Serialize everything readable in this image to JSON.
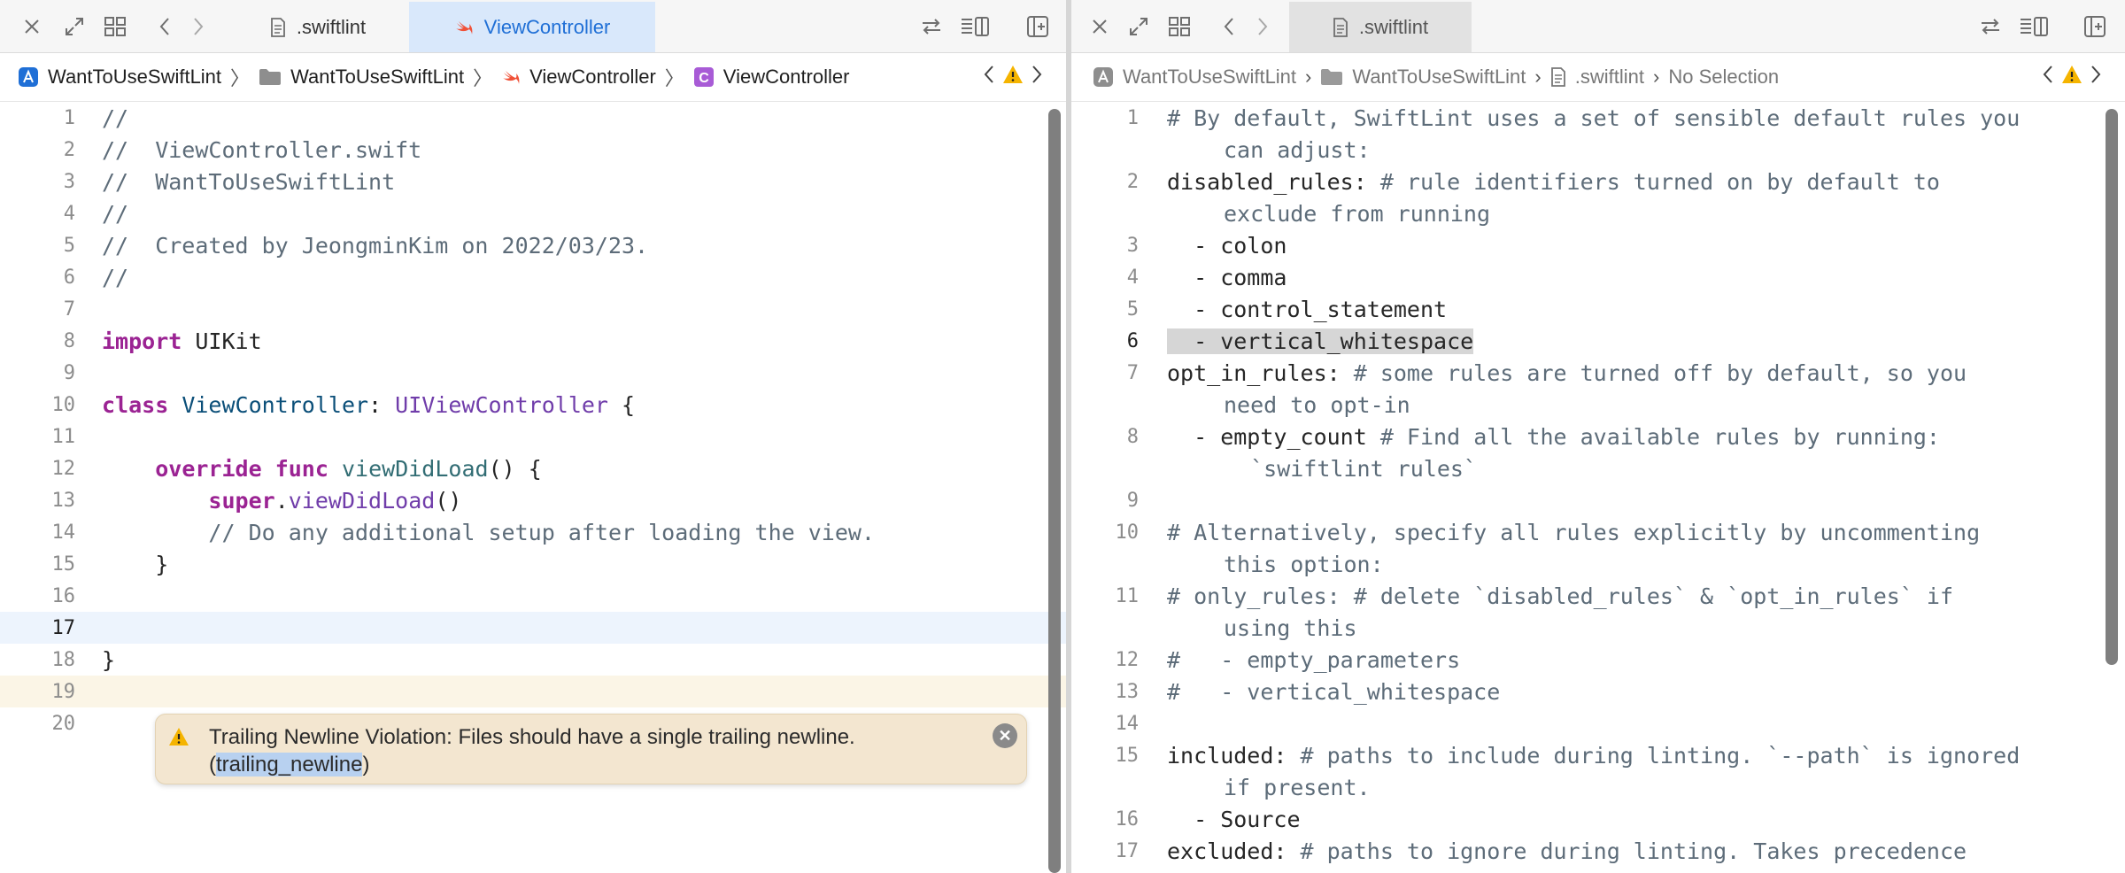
{
  "left_pane": {
    "tabs": [
      {
        "label": ".swiftlint"
      },
      {
        "label": "ViewController"
      }
    ],
    "breadcrumbs": [
      "WantToUseSwiftLint",
      "WantToUseSwiftLint",
      "ViewController",
      "ViewController"
    ],
    "current_line": "17",
    "lines": [
      {
        "n": "1",
        "text": "//"
      },
      {
        "n": "2",
        "text": "//  ViewController.swift"
      },
      {
        "n": "3",
        "text": "//  WantToUseSwiftLint"
      },
      {
        "n": "4",
        "text": "//"
      },
      {
        "n": "5",
        "text": "//  Created by JeongminKim on 2022/03/23."
      },
      {
        "n": "6",
        "text": "//"
      },
      {
        "n": "7",
        "text": ""
      },
      {
        "n": "8",
        "kw": "import",
        "rest": " UIKit"
      },
      {
        "n": "9",
        "text": ""
      },
      {
        "n": "10",
        "kw": "class",
        "name": "ViewController",
        "colon": ": ",
        "sup": "UIViewController",
        "tail": " {"
      },
      {
        "n": "11",
        "text": ""
      },
      {
        "n": "12",
        "kw1": "override",
        "kw2": "func",
        "fname": "viewDidLoad",
        "tail": "() {"
      },
      {
        "n": "13",
        "kw": "super",
        "dot": ".",
        "call": "viewDidLoad",
        "tail": "()"
      },
      {
        "n": "14",
        "text": "// Do any additional setup after loading the view."
      },
      {
        "n": "15",
        "text": "}"
      },
      {
        "n": "16",
        "text": ""
      },
      {
        "n": "17",
        "text": ""
      },
      {
        "n": "18",
        "text": "}"
      },
      {
        "n": "19",
        "text": ""
      },
      {
        "n": "20",
        "text": ""
      }
    ],
    "warning": {
      "message": "Trailing Newline Violation: Files should have a single trailing newline.",
      "open": "(",
      "rule": "trailing_newline",
      "close": ")"
    }
  },
  "right_pane": {
    "tabs": [
      {
        "label": ".swiftlint"
      }
    ],
    "breadcrumbs": [
      "WantToUseSwiftLint",
      "WantToUseSwiftLint",
      ".swiftlint",
      "No Selection"
    ],
    "current_line": "6",
    "lines": [
      {
        "n": "1",
        "text": "# By default, SwiftLint uses a set of sensible default rules you",
        "cont": "can adjust:"
      },
      {
        "n": "2",
        "key": "disabled_rules:",
        "text": " # rule identifiers turned on by default to",
        "cont": "exclude from running"
      },
      {
        "n": "3",
        "text": "  - colon"
      },
      {
        "n": "4",
        "text": "  - comma"
      },
      {
        "n": "5",
        "text": "  - control_statement"
      },
      {
        "n": "6",
        "text": "  - vertical_whitespace"
      },
      {
        "n": "7",
        "key": "opt_in_rules:",
        "text": " # some rules are turned off by default, so you",
        "cont": "need to opt-in"
      },
      {
        "n": "8",
        "key": "  - empty_count",
        "text": " # Find all the available rules by running:",
        "cont": "  `swiftlint rules`"
      },
      {
        "n": "9",
        "text": ""
      },
      {
        "n": "10",
        "text": "# Alternatively, specify all rules explicitly by uncommenting",
        "cont": "this option:"
      },
      {
        "n": "11",
        "text": "# only_rules: # delete `disabled_rules` & `opt_in_rules` if",
        "cont": "using this"
      },
      {
        "n": "12",
        "text": "#   - empty_parameters"
      },
      {
        "n": "13",
        "text": "#   - vertical_whitespace"
      },
      {
        "n": "14",
        "text": ""
      },
      {
        "n": "15",
        "key": "included:",
        "text": " # paths to include during linting. `--path` is ignored",
        "cont": "if present."
      },
      {
        "n": "16",
        "text": "  - Source"
      },
      {
        "n": "17",
        "key": "excluded:",
        "text": " # paths to ignore during linting. Takes precedence"
      }
    ]
  },
  "colors": {
    "accent": "#1f6fd6",
    "warning_yellow": "#f5b400",
    "current_line_bg": "#edf4fd",
    "warning_line_bg": "#fbf5e6",
    "selection_bg": "#d6d6d6",
    "keyword": "#9b2393",
    "comment": "#5d6c79"
  },
  "icons": [
    "close-icon",
    "expand-icon",
    "grid-icon",
    "back-chevron-icon",
    "forward-chevron-icon",
    "document-icon",
    "swift-icon",
    "swap-icon",
    "editor-options-icon",
    "add-editor-icon",
    "app-icon",
    "folder-icon",
    "class-c-icon",
    "warning-icon"
  ]
}
